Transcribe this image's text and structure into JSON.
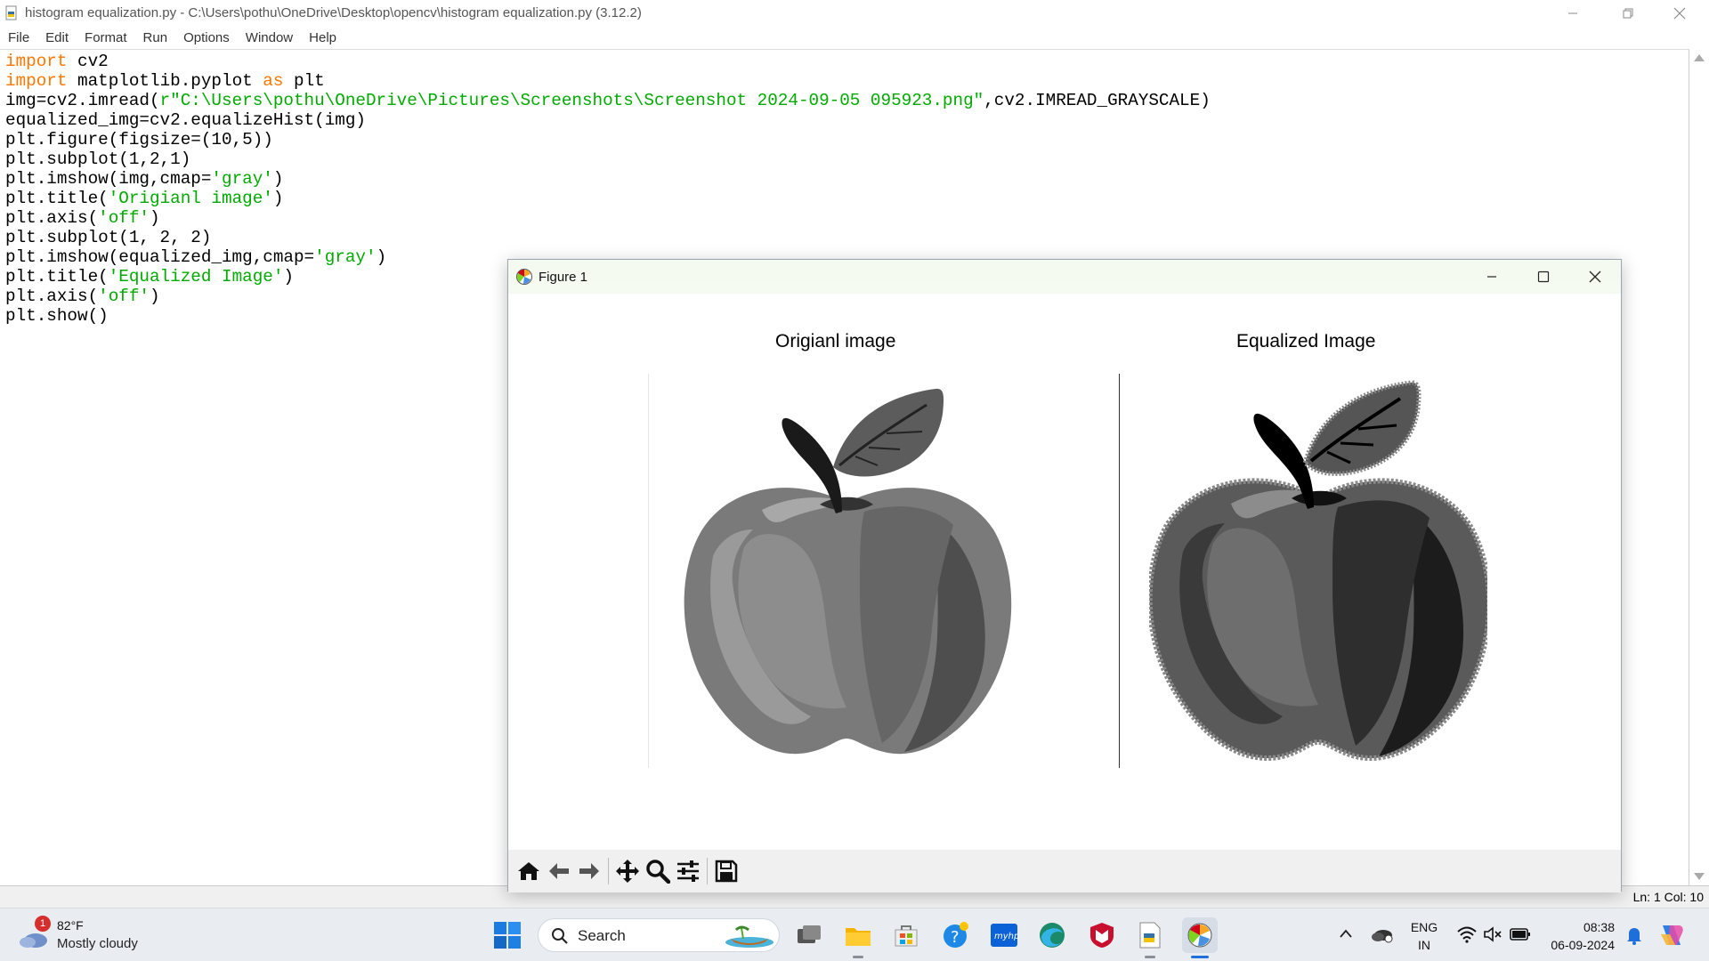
{
  "idle": {
    "title": "histogram equalization.py - C:\\Users\\pothu\\OneDrive\\Desktop\\opencv\\histogram equalization.py (3.12.2)",
    "menu": [
      "File",
      "Edit",
      "Format",
      "Run",
      "Options",
      "Window",
      "Help"
    ],
    "code_lines": [
      [
        {
          "t": "import",
          "c": "kw"
        },
        {
          "t": " cv2",
          "c": ""
        }
      ],
      [
        {
          "t": "import",
          "c": "kw"
        },
        {
          "t": " matplotlib.pyplot ",
          "c": ""
        },
        {
          "t": "as",
          "c": "kw"
        },
        {
          "t": " plt",
          "c": ""
        }
      ],
      [
        {
          "t": "img=cv2.imread(",
          "c": ""
        },
        {
          "t": "r\"C:\\Users\\pothu\\OneDrive\\Pictures\\Screenshots\\Screenshot 2024-09-05 095923.png\"",
          "c": "str"
        },
        {
          "t": ",cv2.IMREAD_GRAYSCALE)",
          "c": ""
        }
      ],
      [
        {
          "t": "equalized_img=cv2.equalizeHist(img)",
          "c": ""
        }
      ],
      [
        {
          "t": "plt.figure(figsize=(10,5))",
          "c": ""
        }
      ],
      [
        {
          "t": "plt.subplot(1,2,1)",
          "c": ""
        }
      ],
      [
        {
          "t": "plt.imshow(img,cmap=",
          "c": ""
        },
        {
          "t": "'gray'",
          "c": "str"
        },
        {
          "t": ")",
          "c": ""
        }
      ],
      [
        {
          "t": "plt.title(",
          "c": ""
        },
        {
          "t": "'Origianl image'",
          "c": "str"
        },
        {
          "t": ")",
          "c": ""
        }
      ],
      [
        {
          "t": "plt.axis(",
          "c": ""
        },
        {
          "t": "'off'",
          "c": "str"
        },
        {
          "t": ")",
          "c": ""
        }
      ],
      [
        {
          "t": "plt.subplot(1, 2, 2)",
          "c": ""
        }
      ],
      [
        {
          "t": "plt.imshow(equalized_img,cmap=",
          "c": ""
        },
        {
          "t": "'gray'",
          "c": "str"
        },
        {
          "t": ")",
          "c": ""
        }
      ],
      [
        {
          "t": "plt.title(",
          "c": ""
        },
        {
          "t": "'Equalized Image'",
          "c": "str"
        },
        {
          "t": ")",
          "c": ""
        }
      ],
      [
        {
          "t": "plt.axis(",
          "c": ""
        },
        {
          "t": "'off'",
          "c": "str"
        },
        {
          "t": ")",
          "c": ""
        }
      ],
      [
        {
          "t": "plt.show()",
          "c": ""
        }
      ]
    ],
    "status": "Ln: 1   Col: 10"
  },
  "figure": {
    "title": "Figure 1",
    "left_title": "Origianl image",
    "right_title": "Equalized Image",
    "toolbar_icons": [
      "home-icon",
      "back-arrow-icon",
      "forward-arrow-icon",
      "pan-icon",
      "zoom-icon",
      "configure-subplots-icon",
      "save-icon"
    ]
  },
  "taskbar": {
    "weather_badge": "1",
    "weather_temp": "82°F",
    "weather_cond": "Mostly cloudy",
    "search_label": "Search",
    "lang_top": "ENG",
    "lang_bottom": "IN",
    "time": "08:38",
    "date": "06-09-2024"
  },
  "colors": {
    "keyword": "#ff7700",
    "string": "#00aa00",
    "figure_titlebar": "#f4faf0",
    "taskbar": "#e9edf2"
  }
}
